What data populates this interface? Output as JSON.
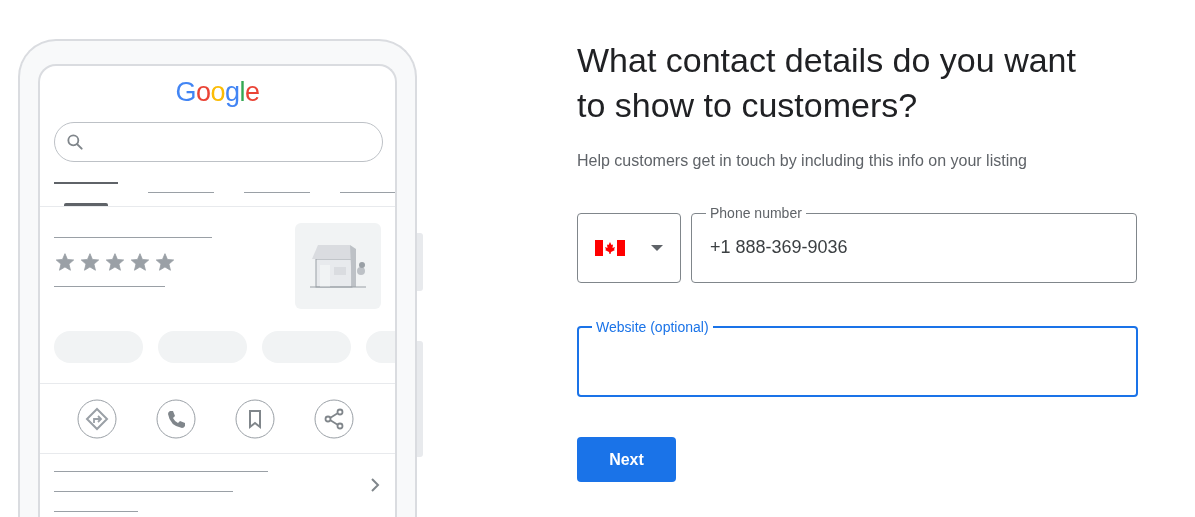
{
  "illustration": {
    "logo": "Google",
    "stars": 5
  },
  "form": {
    "title": "What contact details do you want to show to customers?",
    "subtitle": "Help customers get in touch by including this info on your listing",
    "phone": {
      "label": "Phone number",
      "value": "+1 888-369-9036",
      "focused": false
    },
    "website": {
      "label": "Website (optional)",
      "focused": true
    },
    "next_button": {
      "label": "Next"
    }
  }
}
